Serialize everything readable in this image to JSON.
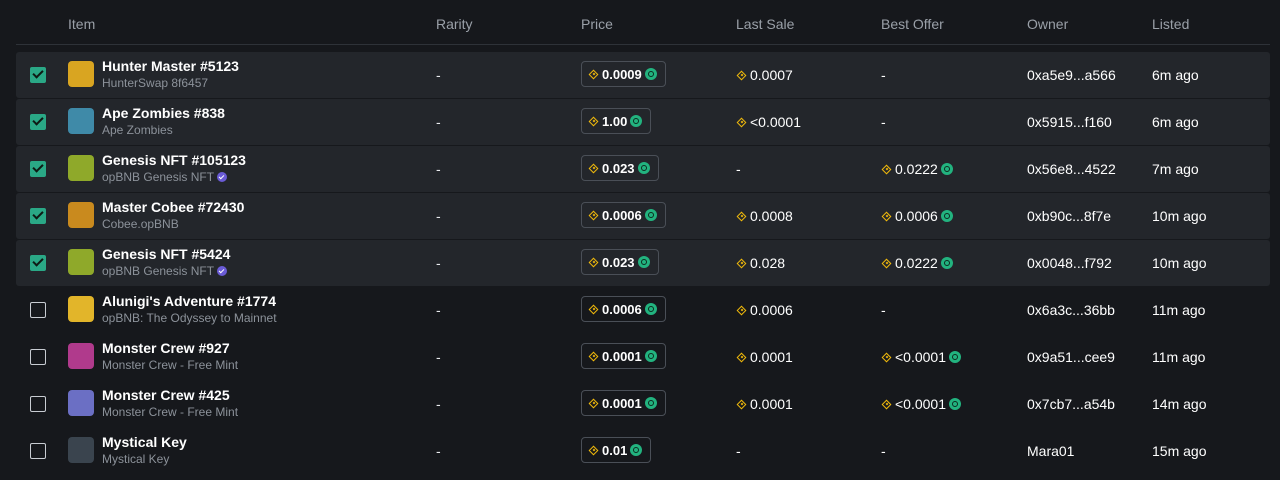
{
  "headers": {
    "item": "Item",
    "rarity": "Rarity",
    "price": "Price",
    "last_sale": "Last Sale",
    "best_offer": "Best Offer",
    "owner": "Owner",
    "listed": "Listed"
  },
  "colors": {
    "accent": "#2aa886",
    "bnb": "#f0b90b",
    "token": "#22b37f",
    "verified": "#6a5bd6"
  },
  "rows": [
    {
      "selected": true,
      "name": "Hunter Master #5123",
      "collection": "HunterSwap 8f6457",
      "verified": false,
      "rarity": "-",
      "price": "0.0009",
      "last_sale": "0.0007",
      "best_offer": "-",
      "owner": "0xa5e9...a566",
      "listed": "6m ago",
      "thumb_color": "#d9a521"
    },
    {
      "selected": true,
      "name": "Ape Zombies #838",
      "collection": "Ape Zombies",
      "verified": false,
      "rarity": "-",
      "price": "1.00",
      "last_sale": "<0.0001",
      "best_offer": "-",
      "owner": "0x5915...f160",
      "listed": "6m ago",
      "thumb_color": "#3f8aa8"
    },
    {
      "selected": true,
      "name": "Genesis NFT #105123",
      "collection": "opBNB Genesis NFT",
      "verified": true,
      "rarity": "-",
      "price": "0.023",
      "last_sale": "-",
      "best_offer": "0.0222",
      "owner": "0x56e8...4522",
      "listed": "7m ago",
      "thumb_color": "#8fa92a"
    },
    {
      "selected": true,
      "name": "Master Cobee #72430",
      "collection": "Cobee.opBNB",
      "verified": false,
      "rarity": "-",
      "price": "0.0006",
      "last_sale": "0.0008",
      "best_offer": "0.0006",
      "owner": "0xb90c...8f7e",
      "listed": "10m ago",
      "thumb_color": "#c98a1e"
    },
    {
      "selected": true,
      "name": "Genesis NFT #5424",
      "collection": "opBNB Genesis NFT",
      "verified": true,
      "rarity": "-",
      "price": "0.023",
      "last_sale": "0.028",
      "best_offer": "0.0222",
      "owner": "0x0048...f792",
      "listed": "10m ago",
      "thumb_color": "#8fa92a"
    },
    {
      "selected": false,
      "name": "Alunigi's Adventure #1774",
      "collection": "opBNB: The Odyssey to Mainnet",
      "verified": false,
      "rarity": "-",
      "price": "0.0006",
      "last_sale": "0.0006",
      "best_offer": "-",
      "owner": "0x6a3c...36bb",
      "listed": "11m ago",
      "thumb_color": "#e2b52a"
    },
    {
      "selected": false,
      "name": "Monster Crew #927",
      "collection": "Monster Crew - Free Mint",
      "verified": false,
      "rarity": "-",
      "price": "0.0001",
      "last_sale": "0.0001",
      "best_offer": "<0.0001",
      "owner": "0x9a51...cee9",
      "listed": "11m ago",
      "thumb_color": "#b03a8c"
    },
    {
      "selected": false,
      "name": "Monster Crew #425",
      "collection": "Monster Crew - Free Mint",
      "verified": false,
      "rarity": "-",
      "price": "0.0001",
      "last_sale": "0.0001",
      "best_offer": "<0.0001",
      "owner": "0x7cb7...a54b",
      "listed": "14m ago",
      "thumb_color": "#6b6fc4"
    },
    {
      "selected": false,
      "name": "Mystical Key",
      "collection": "Mystical Key",
      "verified": false,
      "rarity": "-",
      "price": "0.01",
      "last_sale": "-",
      "best_offer": "-",
      "owner": "Mara01",
      "listed": "15m ago",
      "thumb_color": "#3a444e"
    }
  ]
}
